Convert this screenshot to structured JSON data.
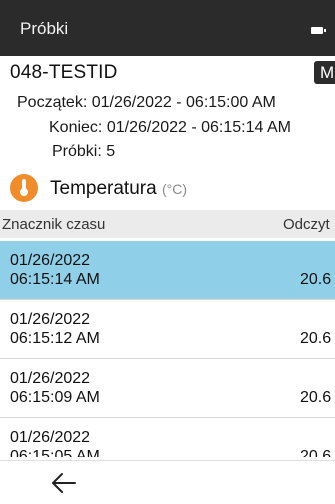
{
  "header": {
    "title": "Próbki",
    "battery_icon": "battery-icon"
  },
  "record": {
    "id": "048-TESTID",
    "mode_badge": "M",
    "start_label": "Początek:",
    "start_value": "01/26/2022 - 06:15:00 AM",
    "end_label": "Koniec:",
    "end_value": "01/26/2022 - 06:15:14 AM",
    "samples_label": "Próbki:",
    "samples_value": "5"
  },
  "sensor": {
    "name": "Temperatura",
    "unit": "(°C)",
    "icon": "thermometer-icon",
    "icon_color": "#f08c2a"
  },
  "table": {
    "col_timestamp": "Znacznik czasu",
    "col_reading": "Odczyt",
    "rows": [
      {
        "date": "01/26/2022",
        "time": "06:15:14 AM",
        "value": "20.6",
        "selected": true
      },
      {
        "date": "01/26/2022",
        "time": "06:15:12 AM",
        "value": "20.6",
        "selected": false
      },
      {
        "date": "01/26/2022",
        "time": "06:15:09 AM",
        "value": "20.6",
        "selected": false
      },
      {
        "date": "01/26/2022",
        "time": "06:15:05 AM",
        "value": "20.6",
        "selected": false
      }
    ],
    "selected_color": "#8fd0e8"
  },
  "footer": {
    "back_icon": "arrow-left-icon"
  }
}
